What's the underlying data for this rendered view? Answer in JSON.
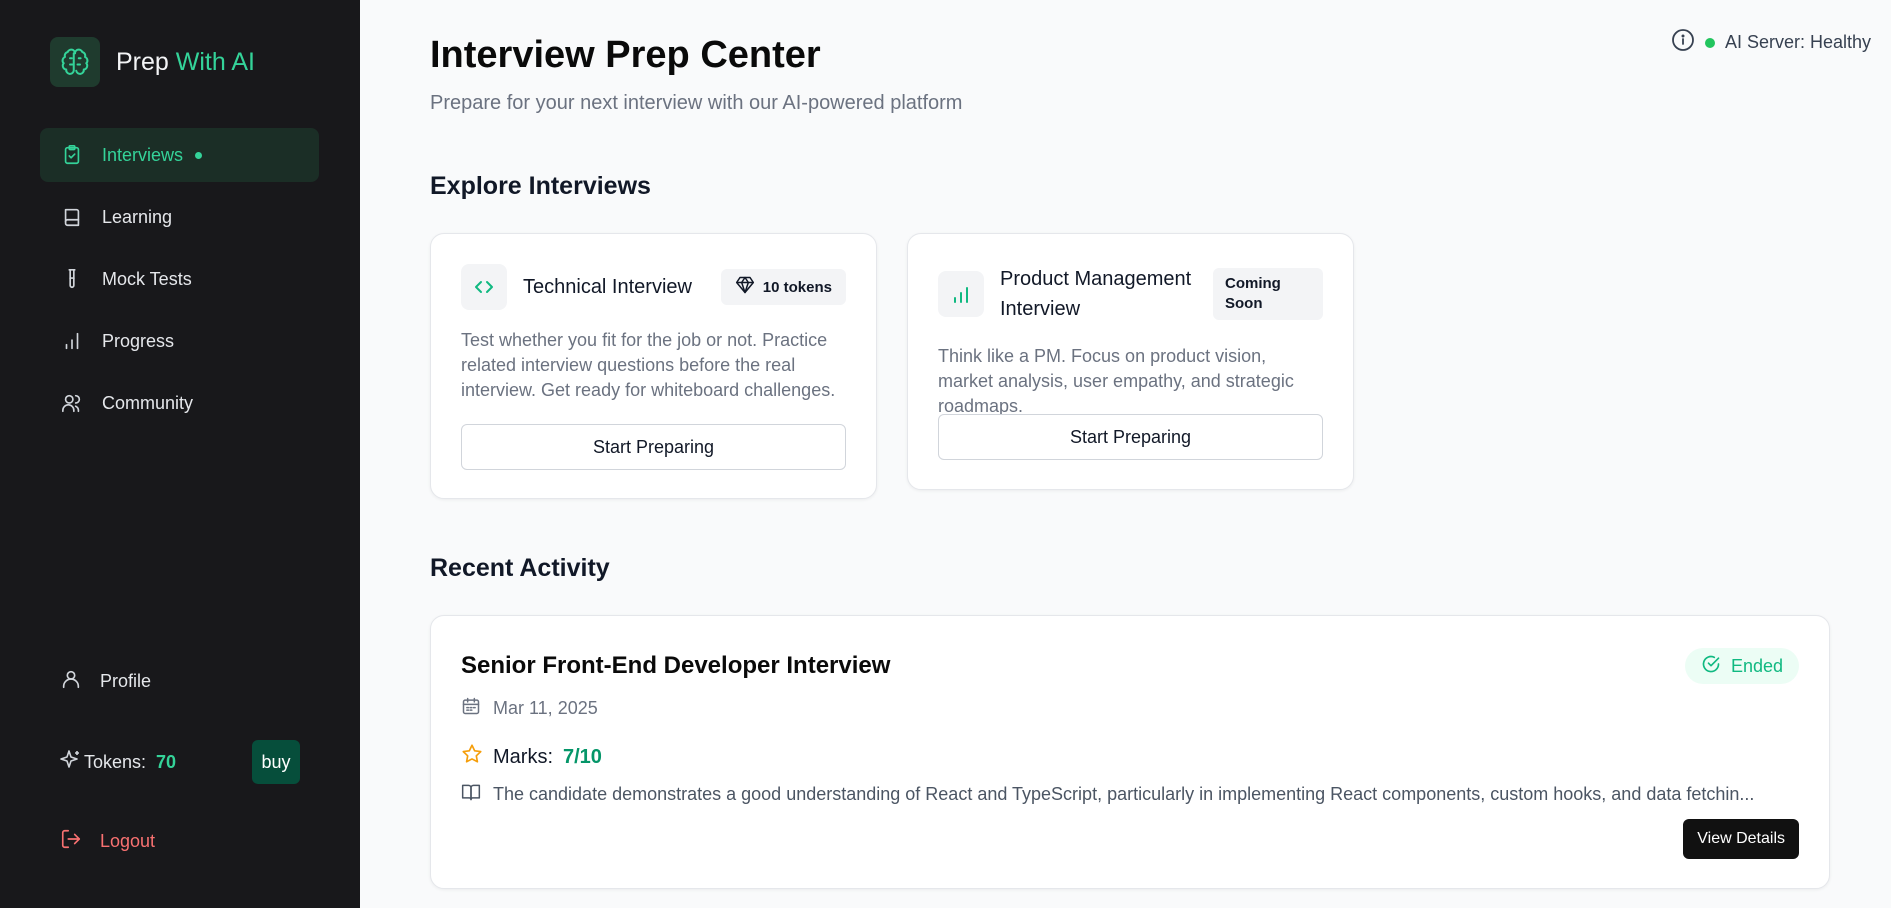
{
  "brand": {
    "name_part1": "Prep",
    "name_part2": "With AI",
    "logo_icon": "brain-icon"
  },
  "sidebar": {
    "items": [
      {
        "label": "Interviews",
        "icon": "clipboard-check-icon",
        "active": true
      },
      {
        "label": "Learning",
        "icon": "book-icon",
        "active": false
      },
      {
        "label": "Mock Tests",
        "icon": "test-tube-icon",
        "active": false
      },
      {
        "label": "Progress",
        "icon": "bar-chart-icon",
        "active": false
      },
      {
        "label": "Community",
        "icon": "users-icon",
        "active": false
      }
    ],
    "profile_label": "Profile",
    "tokens_label": "Tokens:",
    "tokens_count": "70",
    "buy_label": "buy",
    "logout_label": "Logout"
  },
  "header": {
    "title": "Interview Prep Center",
    "subtitle": "Prepare for your next interview with our AI-powered platform",
    "server_status": "AI Server: Healthy"
  },
  "explore": {
    "title": "Explore Interviews",
    "cards": [
      {
        "title": "Technical Interview",
        "badge": "10 tokens",
        "description": "Test whether you fit for the job or not. Practice related interview questions before the real interview. Get ready for whiteboard challenges.",
        "button": "Start Preparing"
      },
      {
        "title": "Product Management Interview",
        "badge": "Coming Soon",
        "description": "Think like a PM. Focus on product vision, market analysis, user empathy, and strategic roadmaps.",
        "button": "Start Preparing"
      }
    ]
  },
  "recent": {
    "title": "Recent Activity",
    "items": [
      {
        "title": "Senior Front-End Developer Interview",
        "status": "Ended",
        "date": "Mar 11, 2025",
        "marks_label": "Marks:",
        "marks_value": "7/10",
        "summary": "The candidate demonstrates a good understanding of React and TypeScript, particularly in implementing React components, custom hooks, and data fetchin...",
        "button": "View Details"
      }
    ]
  },
  "colors": {
    "accent": "#34d399",
    "sidebar_bg": "#18181b",
    "success": "#10b981",
    "danger": "#f87171",
    "marks_star": "#f59e0b"
  }
}
